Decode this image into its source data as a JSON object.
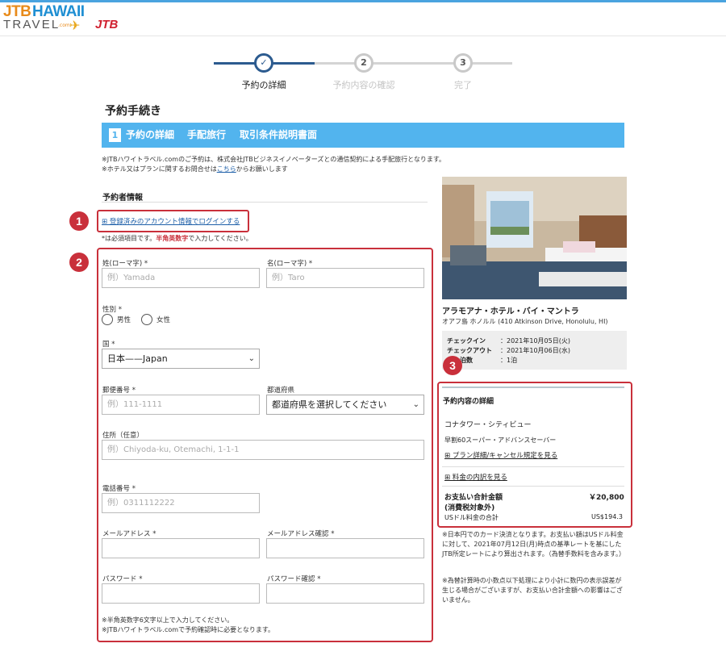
{
  "logo": {
    "jtb": "JTB",
    "hawaii": "HAWAII",
    "travel": "TRAVEL",
    "com": ".com",
    "jtb_mark": "JTB"
  },
  "steps": [
    {
      "num": "✓",
      "label": "予約の詳細"
    },
    {
      "num": "2",
      "label": "予約内容の確認"
    },
    {
      "num": "3",
      "label": "完了"
    }
  ],
  "page_title": "予約手続き",
  "tabs": {
    "num": "1",
    "items": [
      "予約の詳細",
      "手配旅行",
      "取引条件説明書面"
    ]
  },
  "notice": {
    "line1": "※JTBハワイトラベル.comのご予約は、株式会社JTBビジネスイノベーターズとの通信契約による手配旅行となります。",
    "line2_pre": "※ホテル又はプランに関するお問合せは",
    "line2_link": "こちら",
    "line2_post": "からお願いします"
  },
  "section_title": "予約者情報",
  "login_link": "⊞ 登録済みのアカウント情報でログインする",
  "required_note": {
    "pre": "*は必須項目です。",
    "bold": "半角英数字",
    "post": "で入力してください。"
  },
  "badges": [
    "1",
    "2",
    "3"
  ],
  "form": {
    "last_name": {
      "label": "姓(ローマ字) *",
      "placeholder": "例）Yamada"
    },
    "first_name": {
      "label": "名(ローマ字) *",
      "placeholder": "例）Taro"
    },
    "gender": {
      "label": "性別 *",
      "options": [
        "男性",
        "女性"
      ]
    },
    "country": {
      "label": "国 *",
      "value": "日本——Japan"
    },
    "zip": {
      "label": "郵便番号 *",
      "placeholder": "例）111-1111"
    },
    "prefecture": {
      "label": "都道府県",
      "value": "都道府県を選択してください"
    },
    "address": {
      "label": "住所（任意）",
      "placeholder": "例）Chiyoda-ku, Otemachi, 1-1-1"
    },
    "phone": {
      "label": "電話番号 *",
      "placeholder": "例）0311112222"
    },
    "email": {
      "label": "メールアドレス *",
      "placeholder": ""
    },
    "email_confirm": {
      "label": "メールアドレス確認 *",
      "placeholder": ""
    },
    "password": {
      "label": "パスワード *",
      "placeholder": ""
    },
    "password_confirm": {
      "label": "パスワード確認 *",
      "placeholder": ""
    },
    "pw_note1": "※半角英数字6文字以上で入力してください。",
    "pw_note2": "※JTBハワイトラベル.comで予約確認時に必要となります。"
  },
  "hotel": {
    "name": "アラモアナ・ホテル・バイ・マントラ",
    "address": "オアフ島 ホノルル (410 Atkinson Drive, Honolulu, HI)",
    "checkin_label": "チェックイン",
    "checkin_value": "：2021年10月05日(火)",
    "checkout_label": "チェックアウト",
    "checkout_value": "：2021年10月06日(水)",
    "nights_label": "泊数",
    "nights_value": "：1泊"
  },
  "details": {
    "title": "予約内容の詳細",
    "room": "コナタワー・シティビュー",
    "plan": "早割60スーパー・アドバンスセーバー",
    "plan_link": "⊞ プラン詳細/キャンセル規定を見る",
    "price_link": "⊞ 料金の内訳を見る",
    "total_label": "お支払い合計金額",
    "total_value": "￥20,800",
    "tax_note": "(消費税対象外)",
    "usd_label": "USドル料金の合計",
    "usd_value": "US$194.3"
  },
  "fine_print": {
    "p1": "※日本円でのカード決済となります。お支払い額はUSドル料金に対して、2021年07月12日(月)時点の基準レートを基にしたJTB所定レートにより算出されます。（為替手数料を含みます。）",
    "p2": "※為替計算時の小数点以下処理により小計に数円の表示誤差が生じる場合がございますが、お支払い合計金額への影響はございません。"
  },
  "colors": {
    "accent": "#52b4ee",
    "progress": "#2c5b8f",
    "highlight": "#c9303b"
  }
}
